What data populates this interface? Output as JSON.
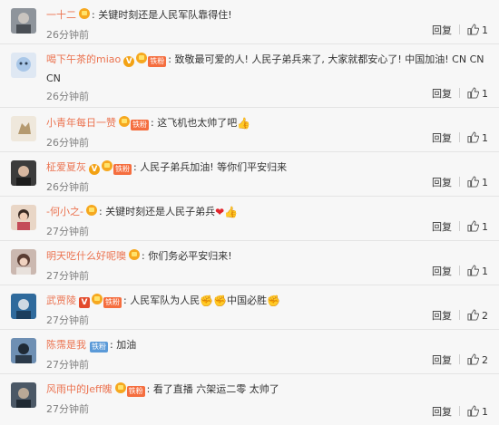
{
  "comments": [
    {
      "user": "一十二",
      "text": "关键时刻还是人民军队靠得住!",
      "time": "26分钟前",
      "reply": "回复",
      "likes": "1"
    },
    {
      "user": "喝下午茶的miao",
      "text": "致敬最可爱的人! 人民子弟兵来了, 大家就都安心了! 中国加油! CN CN CN",
      "fan": "铁粉",
      "time": "26分钟前",
      "reply": "回复",
      "likes": "1"
    },
    {
      "user": "小青年每日一赞",
      "text": "这飞机也太帅了吧",
      "fan": "铁粉",
      "time": "26分钟前",
      "reply": "回复",
      "likes": "1"
    },
    {
      "user": "柾爱夏灰",
      "text": "人民子弟兵加油! 等你们平安归来",
      "fan": "铁粉",
      "time": "26分钟前",
      "reply": "回复",
      "likes": "1"
    },
    {
      "user": "-何小之-",
      "text": "关键时刻还是人民子弟兵",
      "time": "27分钟前",
      "reply": "回复",
      "likes": "1"
    },
    {
      "user": "明天吃什么好呢噢",
      "text": "你们务必平安归来!",
      "time": "27分钟前",
      "reply": "回复",
      "likes": "1"
    },
    {
      "user": "武贾陵",
      "text": "人民军队为人民",
      "text2": "中国必胜",
      "fan": "铁粉",
      "time": "27分钟前",
      "reply": "回复",
      "likes": "2"
    },
    {
      "user": "陈霈是我",
      "text": "加油",
      "fan": "铁粉",
      "time": "27分钟前",
      "reply": "回复",
      "likes": "2"
    },
    {
      "user": "风雨中的Jeff魄",
      "text": "看了直播 六架运二零 太帅了",
      "fan": "铁粉",
      "time": "27分钟前",
      "reply": "回复",
      "likes": "1"
    }
  ],
  "colors": {
    "username": "#eb7350",
    "fan_badge": "#f56e3f",
    "fan_badge_blue": "#5b9ad8",
    "vip": "#f3a214",
    "time": "#808080"
  }
}
